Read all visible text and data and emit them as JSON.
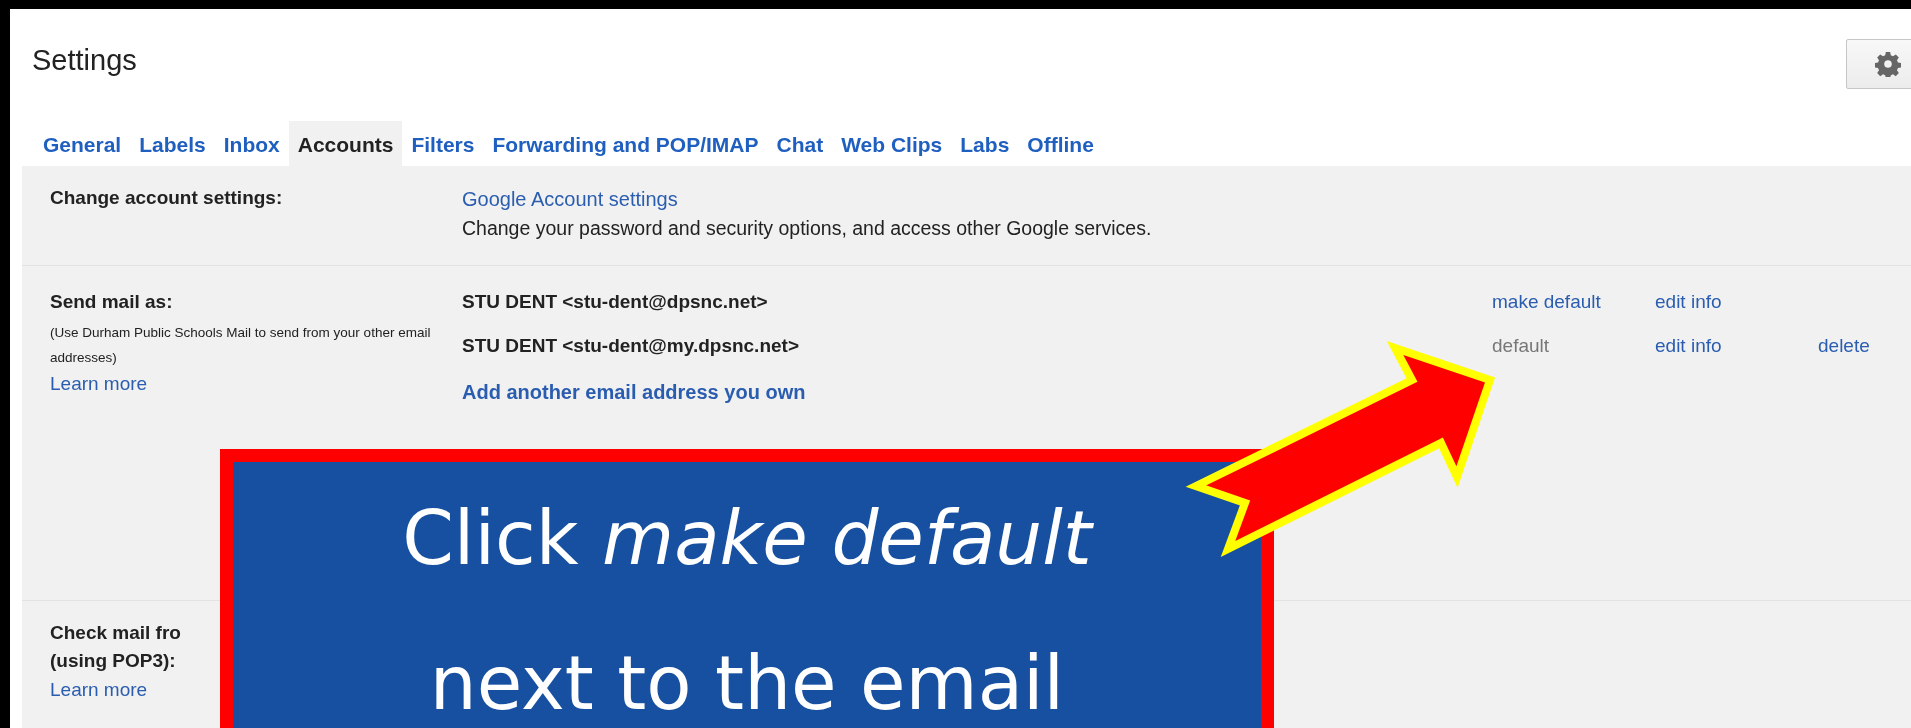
{
  "page": {
    "title": "Settings"
  },
  "tabs": [
    {
      "label": "General",
      "selected": false
    },
    {
      "label": "Labels",
      "selected": false
    },
    {
      "label": "Inbox",
      "selected": false
    },
    {
      "label": "Accounts",
      "selected": true
    },
    {
      "label": "Filters",
      "selected": false
    },
    {
      "label": "Forwarding and POP/IMAP",
      "selected": false
    },
    {
      "label": "Chat",
      "selected": false
    },
    {
      "label": "Web Clips",
      "selected": false
    },
    {
      "label": "Labs",
      "selected": false
    },
    {
      "label": "Offline",
      "selected": false
    }
  ],
  "sections": [
    {
      "label": "Change account settings:",
      "link": "Google Account settings",
      "description": "Change your password and security options, and access other Google services."
    },
    {
      "label": "Send mail as:",
      "note": "(Use Durham Public Schools Mail to send from your other email addresses)",
      "learn_more": "Learn more",
      "addresses": [
        {
          "address": "STU DENT <stu-dent@dpsnc.net>",
          "actions": [
            {
              "kind": "link",
              "text": "make default"
            },
            {
              "kind": "link",
              "text": "edit info"
            }
          ]
        },
        {
          "address": "STU DENT <stu-dent@my.dpsnc.net>",
          "actions": [
            {
              "kind": "status",
              "text": "default"
            },
            {
              "kind": "link",
              "text": "edit info"
            },
            {
              "kind": "link",
              "text": "delete"
            }
          ]
        }
      ],
      "add_link": "Add another email address you own"
    },
    {
      "label": "Check mail fro",
      "sublabel": "(using POP3):",
      "learn_more": "Learn more"
    }
  ],
  "callout": {
    "lines": [
      "Click *make default*",
      "next to the email"
    ]
  }
}
